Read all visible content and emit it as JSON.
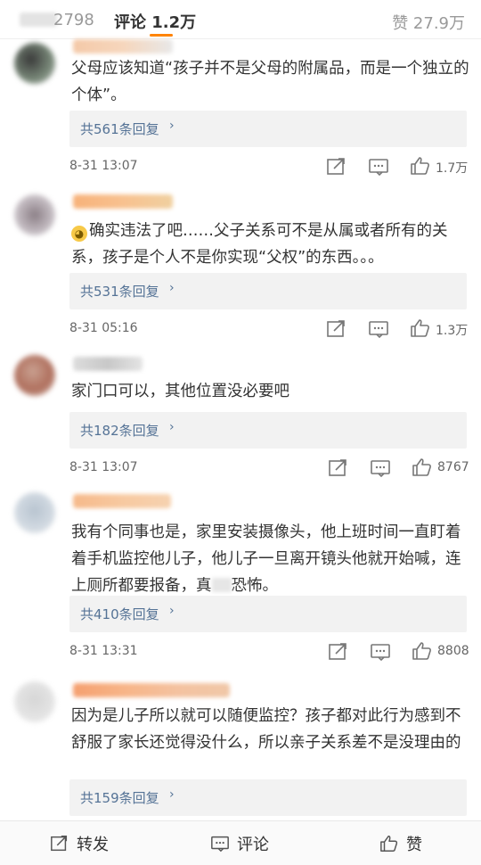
{
  "header": {
    "reposts_label": "2798",
    "comments_label": "评论 1.2万",
    "likes_label": "赞 27.9万"
  },
  "comments": [
    {
      "text": "父母应该知道“孩子并不是父母的附属品，而是一个独立的个体”。",
      "replies": "共561条回复",
      "time": "8-31 13:07",
      "likes": "1.7万"
    },
    {
      "text": "确实违法了吧……父子关系可不是从属或者所有的关系，孩子是个人不是你实现“父权”的东西。。。",
      "replies": "共531条回复",
      "time": "8-31 05:16",
      "likes": "1.3万"
    },
    {
      "text": "家门口可以，其他位置没必要吧",
      "replies": "共182条回复",
      "time": "8-31 13:07",
      "likes": "8767"
    },
    {
      "text_a": "我有个同事也是，家里安装摄像头，他上班时间一直盯着着手机监控他儿子，他儿子一旦离开镜头他就开始喊，连上厕所都要报备，真",
      "text_b": "恐怖。",
      "replies": "共410条回复",
      "time": "8-31 13:31",
      "likes": "8808"
    },
    {
      "text": "因为是儿子所以就可以随便监控？孩子都对此行为感到不舒服了家长还觉得没什么，所以亲子关系差不是没理由的",
      "replies": "共159条回复"
    }
  ],
  "bottom_bar": {
    "repost_label": "转发",
    "comment_label": "评论",
    "like_label": "赞"
  },
  "icons": {
    "share": "share-icon",
    "comment": "comment-icon",
    "like": "thumbs-up-icon",
    "chevron": "chevron-right-icon"
  },
  "colors": {
    "link": "#557396",
    "accent": "#ff8200",
    "reply_bg": "#f2f2f2"
  }
}
